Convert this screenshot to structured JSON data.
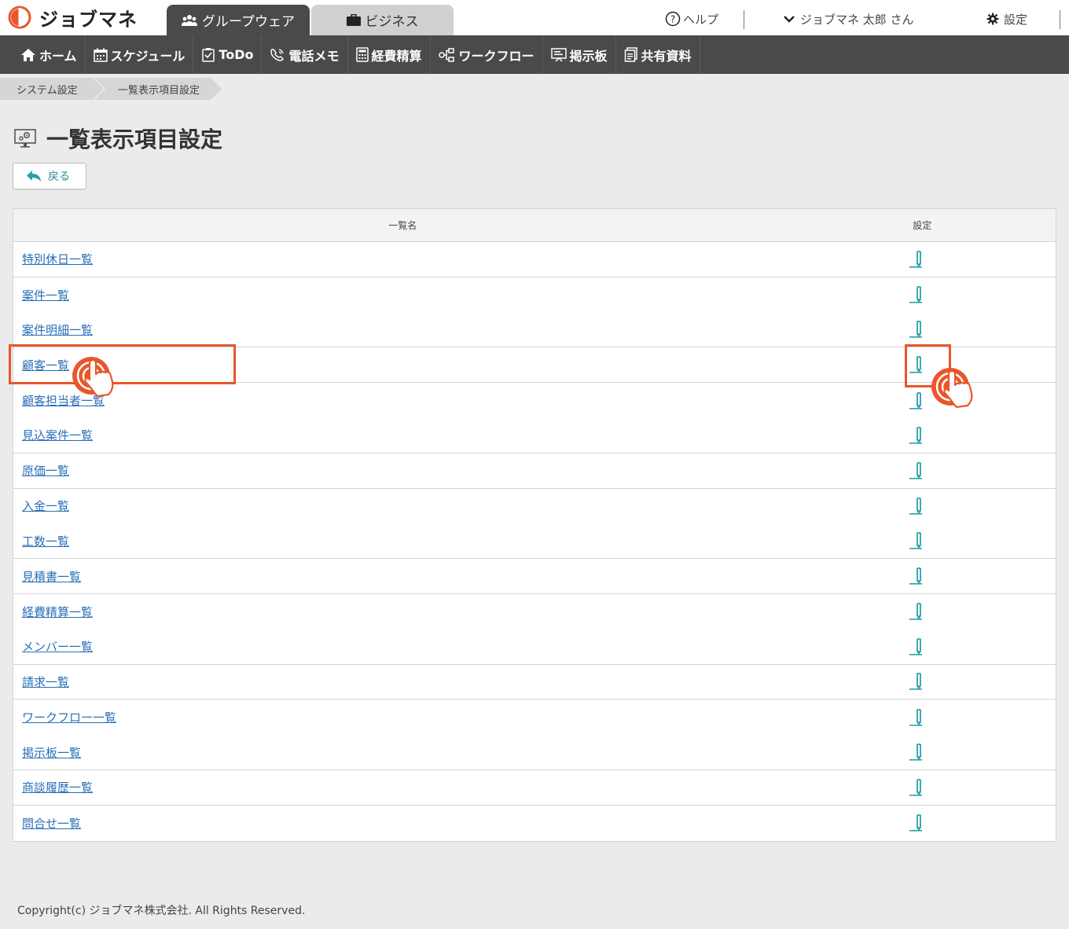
{
  "header": {
    "brand": "ジョブマネ",
    "app_tabs": [
      {
        "label": "グループウェア",
        "icon": "group-icon",
        "active": true
      },
      {
        "label": "ビジネス",
        "icon": "briefcase-icon",
        "active": false
      }
    ],
    "help_label": "ヘルプ",
    "user_label": "ジョブマネ 太郎 さん",
    "settings_label": "設定"
  },
  "nav": {
    "items": [
      {
        "label": "ホーム",
        "icon": "home-icon"
      },
      {
        "label": "スケジュール",
        "icon": "calendar-icon"
      },
      {
        "label": "ToDo",
        "icon": "clipboard-icon"
      },
      {
        "label": "電話メモ",
        "icon": "phone-icon"
      },
      {
        "label": "経費精算",
        "icon": "calculator-icon"
      },
      {
        "label": "ワークフロー",
        "icon": "workflow-icon"
      },
      {
        "label": "掲示板",
        "icon": "board-icon"
      },
      {
        "label": "共有資料",
        "icon": "document-icon"
      }
    ]
  },
  "breadcrumb": [
    "システム設定",
    "一覧表示項目設定"
  ],
  "page": {
    "title": "一覧表示項目設定",
    "back_label": "戻る"
  },
  "table": {
    "col_name": "一覧名",
    "col_setting": "設定",
    "rows": [
      "特別休日一覧",
      "案件一覧",
      "案件明細一覧",
      "顧客一覧",
      "顧客担当者一覧",
      "見込案件一覧",
      "原価一覧",
      "入金一覧",
      "工数一覧",
      "見積書一覧",
      "経費精算一覧",
      "メンバー一覧",
      "請求一覧",
      "ワークフロー一覧",
      "掲示板一覧",
      "商談履歴一覧",
      "問合せ一覧"
    ]
  },
  "footer": {
    "copyright": "Copyright(c) ジョブマネ株式会社. All Rights Reserved."
  },
  "colors": {
    "highlight": "#e8572a",
    "nav_bg": "#4a4a4a",
    "link": "#2a6fb8",
    "accent": "#2aa0a8"
  }
}
